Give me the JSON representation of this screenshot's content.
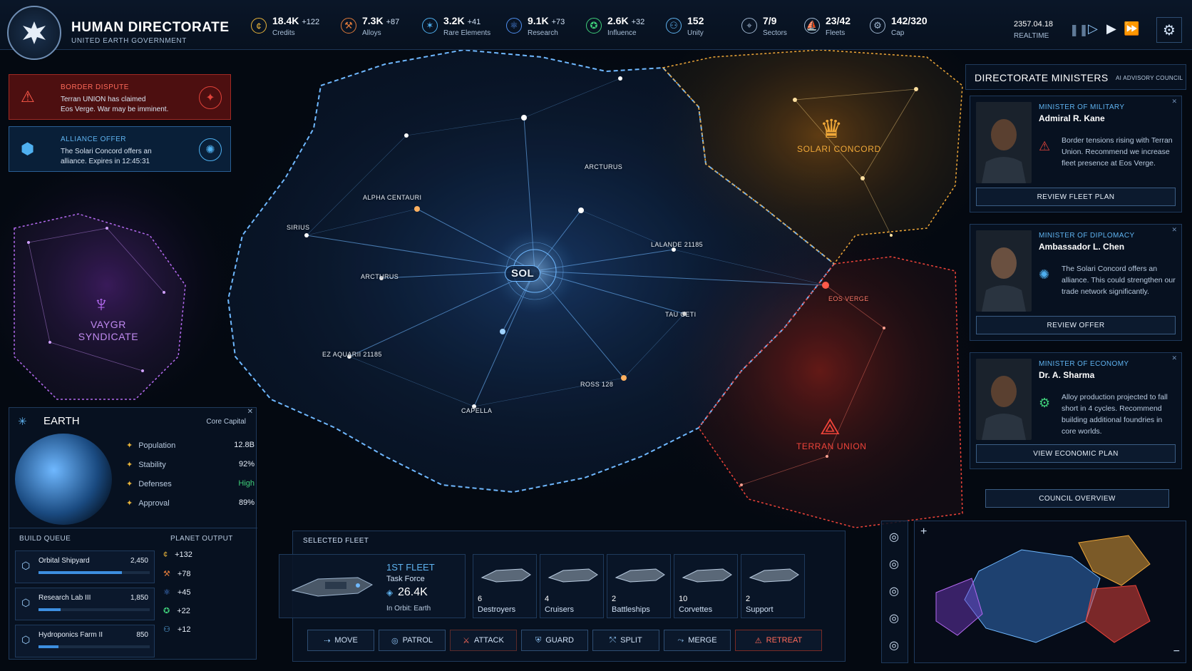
{
  "faction": {
    "name": "HUMAN DIRECTORATE",
    "subtitle": "UNITED EARTH GOVERNMENT"
  },
  "resources": [
    {
      "value": "18.4K",
      "delta": "+122",
      "label": "Credits",
      "icon": "credits-icon",
      "color": "#e8b43a"
    },
    {
      "value": "7.3K",
      "delta": "+87",
      "label": "Alloys",
      "icon": "alloys-icon",
      "color": "#e07a3a"
    },
    {
      "value": "3.2K",
      "delta": "+41",
      "label": "Rare Elements",
      "icon": "rare-elements-icon",
      "color": "#4fb0f0"
    },
    {
      "value": "9.1K",
      "delta": "+73",
      "label": "Research",
      "icon": "research-icon",
      "color": "#4f8ff0"
    },
    {
      "value": "2.6K",
      "delta": "+32",
      "label": "Influence",
      "icon": "influence-icon",
      "color": "#3fcf7a"
    },
    {
      "value": "152",
      "delta": "",
      "label": "Unity",
      "icon": "unity-icon",
      "color": "#5fb3f0"
    },
    {
      "value": "7/9",
      "delta": "",
      "label": "Sectors",
      "icon": "sectors-icon",
      "color": "#9fb6d0"
    },
    {
      "value": "23/42",
      "delta": "",
      "label": "Fleets",
      "icon": "fleets-icon",
      "color": "#9fb6d0"
    },
    {
      "value": "142/320",
      "delta": "",
      "label": "Cap",
      "icon": "cap-icon",
      "color": "#9fb6d0"
    }
  ],
  "time": {
    "date": "2357.04.18",
    "mode": "REALTIME"
  },
  "alerts": [
    {
      "title": "BORDER DISPUTE",
      "line1": "Terran UNION has claimed",
      "line2": "Eos Verge. War may be imminent.",
      "accent": "#e0433a"
    },
    {
      "title": "ALLIANCE OFFER",
      "line1": "The Solari Concord offers an",
      "line2": "alliance. Expires in 12:45:31",
      "accent": "#4fb0f0"
    }
  ],
  "map": {
    "capital": "SOL",
    "systems": [
      "ARCTURUS",
      "ALPHA CENTAURI",
      "SIRIUS",
      "ARCTURUS",
      "LALANDE 21185",
      "TAU CETI",
      "EOS VERGE",
      "EZ AQUARII 21185",
      "ROSS 128",
      "CAPELLA"
    ],
    "factions": [
      {
        "name": "SOLARI CONCORD",
        "color": "#f0a838"
      },
      {
        "name": "VAYGR SYNDICATE",
        "color": "#b46af0"
      },
      {
        "name": "TERRAN UNION",
        "color": "#f0443a"
      }
    ]
  },
  "planet": {
    "name": "EARTH",
    "type": "Core Capital",
    "stats": [
      {
        "label": "Population",
        "value": "12.8B"
      },
      {
        "label": "Stability",
        "value": "92%"
      },
      {
        "label": "Defenses",
        "value": "High"
      },
      {
        "label": "Approval",
        "value": "89%"
      }
    ],
    "build_queue_title": "BUILD QUEUE",
    "build_queue": [
      {
        "name": "Orbital Shipyard",
        "cost": "2,450",
        "progress": 0.75
      },
      {
        "name": "Research Lab III",
        "cost": "1,850",
        "progress": 0.2
      },
      {
        "name": "Hydroponics Farm II",
        "cost": "850",
        "progress": 0.18
      }
    ],
    "output_title": "PLANET OUTPUT",
    "output": [
      {
        "value": "+132",
        "icon": "credits-icon",
        "color": "#e8b43a"
      },
      {
        "value": "+78",
        "icon": "alloys-icon",
        "color": "#e07a3a"
      },
      {
        "value": "+45",
        "icon": "research-icon",
        "color": "#4f8ff0"
      },
      {
        "value": "+22",
        "icon": "influence-icon",
        "color": "#3fcf7a"
      },
      {
        "value": "+12",
        "icon": "unity-icon",
        "color": "#5fb3f0"
      }
    ]
  },
  "fleet": {
    "header": "SELECTED FLEET",
    "name": "1ST FLEET",
    "type": "Task Force",
    "power": "26.4K",
    "location": "In Orbit: Earth",
    "ships": [
      {
        "count": "6",
        "type": "Destroyers"
      },
      {
        "count": "4",
        "type": "Cruisers"
      },
      {
        "count": "2",
        "type": "Battleships"
      },
      {
        "count": "10",
        "type": "Corvettes"
      },
      {
        "count": "2",
        "type": "Support"
      }
    ],
    "actions": [
      "MOVE",
      "PATROL",
      "ATTACK",
      "GUARD",
      "SPLIT",
      "MERGE",
      "RETREAT"
    ]
  },
  "ministers": {
    "title": "DIRECTORATE MINISTERS",
    "subtitle": "AI ADVISORY COUNCIL",
    "list": [
      {
        "role": "MINISTER OF MILITARY",
        "name": "Admiral R. Kane",
        "text": "Border tensions rising with Terran Union. Recommend we increase fleet presence at Eos Verge.",
        "button": "REVIEW FLEET PLAN"
      },
      {
        "role": "MINISTER OF DIPLOMACY",
        "name": "Ambassador L. Chen",
        "text": "The Solari Concord offers an alliance. This could strengthen our trade network significantly.",
        "button": "REVIEW OFFER"
      },
      {
        "role": "MINISTER OF ECONOMY",
        "name": "Dr. A. Sharma",
        "text": "Alloy production projected to fall short in 4 cycles. Recommend building additional foundries in core worlds.",
        "button": "VIEW ECONOMIC PLAN"
      }
    ],
    "council_button": "COUNCIL OVERVIEW"
  }
}
